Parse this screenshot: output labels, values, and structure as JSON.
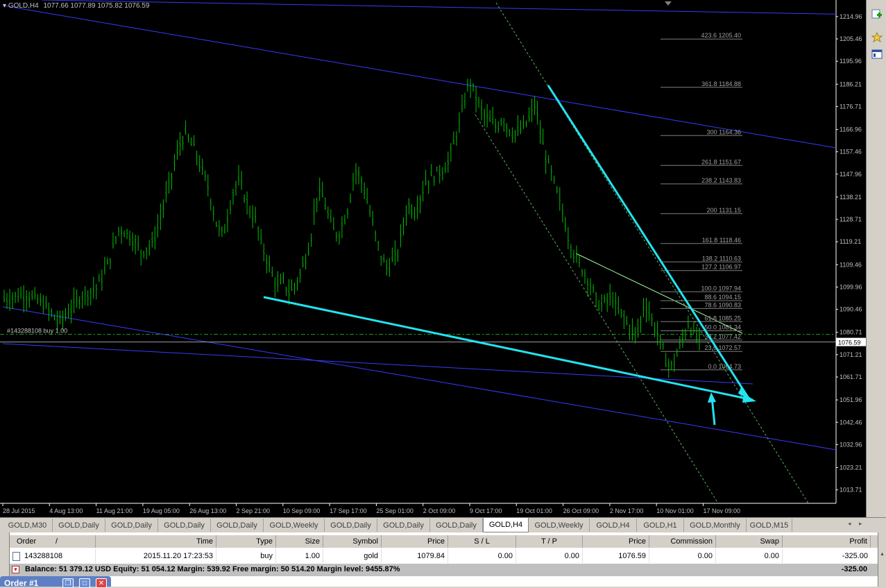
{
  "chart_header": {
    "symbol_tf": "GOLD,H4",
    "ohlc": "1077.66 1077.89 1075.82 1076.59"
  },
  "colors": {
    "background": "#000000",
    "candles": "#00c000",
    "channel": "#3a3aff",
    "trend_cyan": "#22e4f0",
    "fib": "#808080",
    "axis_text": "#c0c0c0",
    "current_price_bg": "#ffffff"
  },
  "order_line_label": "#143288108 buy 1.00",
  "current_price": "1076.59",
  "chart_data": {
    "type": "candlestick",
    "symbol": "GOLD",
    "timeframe": "H4",
    "ylim": [
      1008.0,
      1222.0
    ],
    "y_ticks": [
      "1214.96",
      "1205.46",
      "1195.96",
      "1186.21",
      "1176.71",
      "1166.96",
      "1157.46",
      "1147.96",
      "1138.21",
      "1128.71",
      "1119.21",
      "1109.46",
      "1099.96",
      "1090.46",
      "1080.71",
      "1071.21",
      "1061.71",
      "1051.96",
      "1042.46",
      "1032.96",
      "1023.21",
      "1013.71"
    ],
    "x_ticks": [
      "28 Jul 2015",
      "4 Aug 13:00",
      "11 Aug 21:00",
      "19 Aug 05:00",
      "26 Aug 13:00",
      "2 Sep 21:00",
      "10 Sep 09:00",
      "17 Sep 17:00",
      "25 Sep 01:00",
      "2 Oct 09:00",
      "9 Oct 17:00",
      "19 Oct 01:00",
      "26 Oct 09:00",
      "2 Nov 17:00",
      "10 Nov 01:00",
      "17 Nov 09:00"
    ],
    "price_path": [
      [
        0,
        1095
      ],
      [
        4,
        1097
      ],
      [
        7,
        1093
      ],
      [
        10,
        1085
      ],
      [
        12,
        1090
      ],
      [
        14,
        1096
      ],
      [
        17,
        1100
      ],
      [
        19,
        1110
      ],
      [
        21,
        1125
      ],
      [
        23,
        1122
      ],
      [
        25,
        1115
      ],
      [
        27,
        1118
      ],
      [
        28,
        1125
      ],
      [
        30,
        1142
      ],
      [
        32,
        1160
      ],
      [
        33,
        1165
      ],
      [
        35,
        1158
      ],
      [
        36,
        1150
      ],
      [
        37,
        1145
      ],
      [
        38,
        1135
      ],
      [
        39,
        1125
      ],
      [
        40,
        1122
      ],
      [
        41,
        1132
      ],
      [
        42,
        1142
      ],
      [
        43,
        1145
      ],
      [
        44,
        1138
      ],
      [
        45,
        1132
      ],
      [
        46,
        1128
      ],
      [
        47,
        1118
      ],
      [
        48,
        1112
      ],
      [
        49,
        1105
      ],
      [
        50,
        1100
      ],
      [
        51,
        1102
      ],
      [
        52,
        1098
      ],
      [
        53,
        1100
      ],
      [
        54,
        1105
      ],
      [
        55,
        1112
      ],
      [
        56,
        1120
      ],
      [
        57,
        1138
      ],
      [
        58,
        1140
      ],
      [
        59,
        1132
      ],
      [
        60,
        1125
      ],
      [
        61,
        1122
      ],
      [
        62,
        1128
      ],
      [
        63,
        1135
      ],
      [
        64,
        1150
      ],
      [
        65,
        1147
      ],
      [
        66,
        1140
      ],
      [
        67,
        1130
      ],
      [
        68,
        1120
      ],
      [
        69,
        1112
      ],
      [
        70,
        1108
      ],
      [
        72,
        1115
      ],
      [
        73,
        1128
      ],
      [
        74,
        1135
      ],
      [
        75,
        1132
      ],
      [
        76,
        1138
      ],
      [
        77,
        1145
      ],
      [
        79,
        1148
      ],
      [
        81,
        1152
      ],
      [
        82,
        1160
      ],
      [
        83,
        1168
      ],
      [
        84,
        1178
      ],
      [
        85,
        1188
      ],
      [
        86,
        1182
      ],
      [
        87,
        1176
      ],
      [
        88,
        1172
      ],
      [
        89,
        1170
      ],
      [
        90,
        1168
      ],
      [
        91,
        1172
      ],
      [
        92,
        1168
      ],
      [
        93,
        1165
      ],
      [
        94,
        1166
      ],
      [
        95,
        1168
      ],
      [
        96,
        1172
      ],
      [
        97,
        1178
      ],
      [
        98,
        1165
      ],
      [
        99,
        1155
      ],
      [
        100,
        1148
      ],
      [
        101,
        1140
      ],
      [
        102,
        1132
      ],
      [
        103,
        1122
      ],
      [
        104,
        1115
      ],
      [
        105,
        1110
      ],
      [
        106,
        1106
      ],
      [
        107,
        1102
      ],
      [
        108,
        1095
      ],
      [
        109,
        1092
      ],
      [
        110,
        1094
      ],
      [
        111,
        1096
      ],
      [
        112,
        1090
      ],
      [
        113,
        1088
      ],
      [
        114,
        1084
      ],
      [
        115,
        1080
      ],
      [
        116,
        1082
      ],
      [
        117,
        1094
      ],
      [
        118,
        1088
      ],
      [
        119,
        1082
      ],
      [
        120,
        1076
      ],
      [
        121,
        1068
      ],
      [
        122,
        1066
      ],
      [
        123,
        1072
      ],
      [
        124,
        1078
      ],
      [
        125,
        1085
      ],
      [
        126,
        1080
      ],
      [
        127,
        1077
      ]
    ],
    "fib_levels": [
      {
        "ratio": "423.6",
        "price": "1205.40",
        "value": 1205.4
      },
      {
        "ratio": "361.8",
        "price": "1184.88",
        "value": 1184.88
      },
      {
        "ratio": "300",
        "price": "1164.36",
        "value": 1164.36
      },
      {
        "ratio": "261.8",
        "price": "1151.67",
        "value": 1151.67
      },
      {
        "ratio": "238.2",
        "price": "1143.83",
        "value": 1143.83
      },
      {
        "ratio": "200",
        "price": "1131.15",
        "value": 1131.15
      },
      {
        "ratio": "161.8",
        "price": "1118.46",
        "value": 1118.46
      },
      {
        "ratio": "138.2",
        "price": "1110.63",
        "value": 1110.63
      },
      {
        "ratio": "127.2",
        "price": "1106.97",
        "value": 1106.97
      },
      {
        "ratio": "100.0",
        "price": "1097.94",
        "value": 1097.94
      },
      {
        "ratio": "88.6",
        "price": "1094.15",
        "value": 1094.15
      },
      {
        "ratio": "78.6",
        "price": "1090.83",
        "value": 1090.83
      },
      {
        "ratio": "61.8",
        "price": "1085.25",
        "value": 1085.25
      },
      {
        "ratio": "50.0",
        "price": "1081.34",
        "value": 1081.34
      },
      {
        "ratio": "38.2",
        "price": "1077.42",
        "value": 1077.42
      },
      {
        "ratio": "23.6",
        "price": "1072.57",
        "value": 1072.57
      },
      {
        "ratio": "0.0",
        "price": "1064.73",
        "value": 1064.73
      }
    ],
    "order_price": 1079.84,
    "current_price": 1076.59
  },
  "tabs": [
    "GOLD,M30",
    "GOLD,Daily",
    "GOLD,Daily",
    "GOLD,Daily",
    "GOLD,Daily",
    "GOLD,Weekly",
    "GOLD,Daily",
    "GOLD,Daily",
    "GOLD,Daily",
    "GOLD,H4",
    "GOLD,Weekly",
    "GOLD,H4",
    "GOLD,H1",
    "GOLD,Monthly",
    "GOLD,M15"
  ],
  "active_tab": 9,
  "terminal": {
    "columns": [
      "Order",
      "/",
      "Time",
      "Type",
      "Size",
      "Symbol",
      "Price",
      "S / L",
      "T / P",
      "Price",
      "Commission",
      "Swap",
      "Profit"
    ],
    "order": {
      "ticket": "143288108",
      "time": "2015.11.20 17:23:53",
      "type": "buy",
      "size": "1.00",
      "symbol": "gold",
      "price": "1079.84",
      "sl": "0.00",
      "tp": "0.00",
      "current": "1076.59",
      "commission": "0.00",
      "swap": "0.00",
      "profit": "-325.00"
    },
    "balance_line": "Balance: 51 379.12 USD  Equity: 51 054.12  Margin: 539.92  Free margin: 50 514.20  Margin level: 9455.87%",
    "total_profit": "-325.00"
  },
  "order_window": {
    "title": "Order #1"
  }
}
